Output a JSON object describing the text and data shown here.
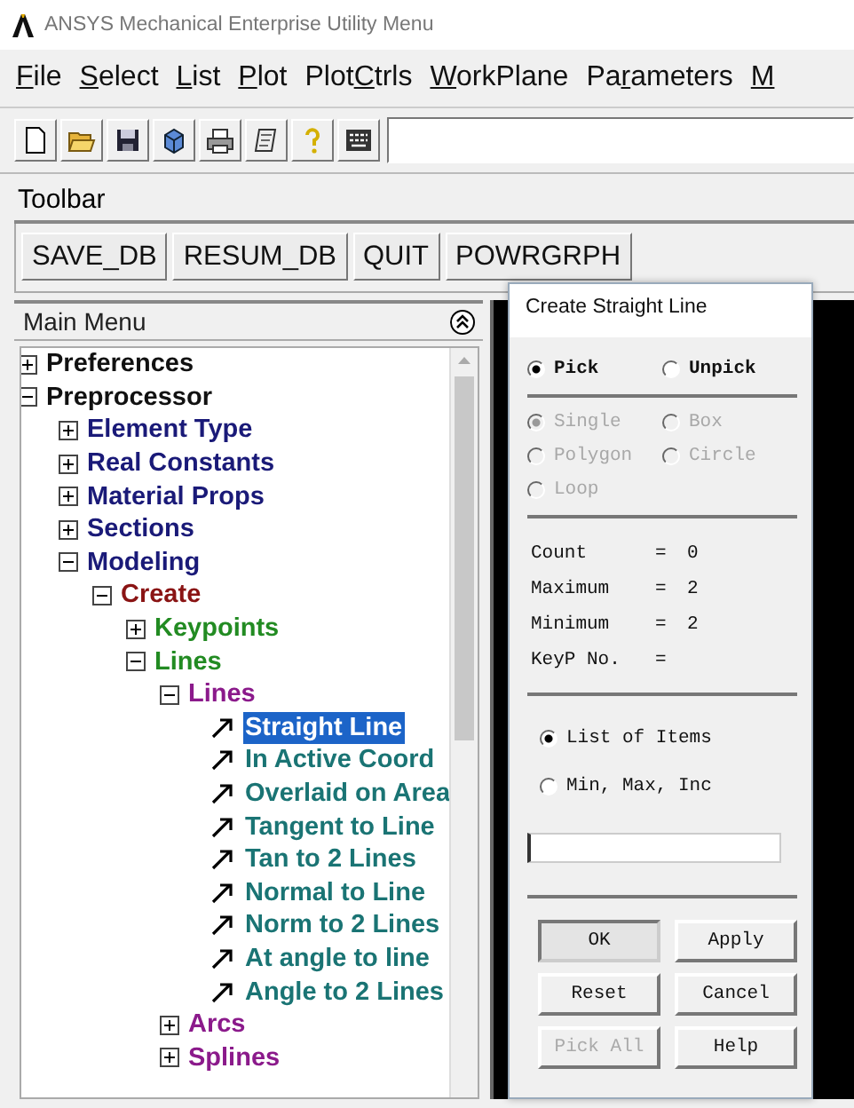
{
  "window": {
    "title": "ANSYS Mechanical Enterprise Utility Menu"
  },
  "menu_bar": [
    {
      "key": "F",
      "after": "ile"
    },
    {
      "key": "S",
      "after": "elect"
    },
    {
      "key": "L",
      "after": "ist"
    },
    {
      "key": "P",
      "after": "lot"
    },
    {
      "before": "Plot",
      "key": "C",
      "after": "trls"
    },
    {
      "key": "W",
      "after": "orkPlane"
    },
    {
      "before": "Pa",
      "key": "r",
      "after": "ameters"
    },
    {
      "key": "M"
    }
  ],
  "toolbar_label": "Toolbar",
  "toolbar_buttons": [
    "SAVE_DB",
    "RESUM_DB",
    "QUIT",
    "POWRGRPH"
  ],
  "main_menu": {
    "title": "Main Menu",
    "tree": [
      {
        "label": "Preferences",
        "kind": "folder",
        "expanded": false,
        "selected": false
      },
      {
        "label": "Preprocessor",
        "kind": "folder",
        "expanded": true,
        "selected": false,
        "children": [
          {
            "label": "Element Type",
            "kind": "folder",
            "expanded": false,
            "selected": false
          },
          {
            "label": "Real Constants",
            "kind": "folder",
            "expanded": false,
            "selected": false
          },
          {
            "label": "Material Props",
            "kind": "folder",
            "expanded": false,
            "selected": false
          },
          {
            "label": "Sections",
            "kind": "folder",
            "expanded": false,
            "selected": false
          },
          {
            "label": "Modeling",
            "kind": "folder",
            "expanded": true,
            "selected": false,
            "children": [
              {
                "label": "Create",
                "kind": "folder",
                "expanded": true,
                "selected": false,
                "children": [
                  {
                    "label": "Keypoints",
                    "kind": "folder",
                    "expanded": false,
                    "selected": false
                  },
                  {
                    "label": "Lines",
                    "kind": "folder",
                    "expanded": true,
                    "selected": false,
                    "children": [
                      {
                        "label": "Lines",
                        "kind": "folder",
                        "expanded": true,
                        "selected": false,
                        "children": [
                          {
                            "label": "Straight Line",
                            "kind": "action",
                            "selected": true
                          },
                          {
                            "label": "In Active Coord",
                            "kind": "action",
                            "selected": false
                          },
                          {
                            "label": "Overlaid on Area",
                            "kind": "action",
                            "selected": false
                          },
                          {
                            "label": "Tangent to Line",
                            "kind": "action",
                            "selected": false
                          },
                          {
                            "label": "Tan to 2 Lines",
                            "kind": "action",
                            "selected": false
                          },
                          {
                            "label": "Normal to Line",
                            "kind": "action",
                            "selected": false
                          },
                          {
                            "label": "Norm to 2 Lines",
                            "kind": "action",
                            "selected": false
                          },
                          {
                            "label": "At angle to line",
                            "kind": "action",
                            "selected": false
                          },
                          {
                            "label": "Angle to 2 Lines",
                            "kind": "action",
                            "selected": false
                          }
                        ]
                      },
                      {
                        "label": "Arcs",
                        "kind": "folder",
                        "expanded": false,
                        "selected": false
                      },
                      {
                        "label": "Splines",
                        "kind": "folder",
                        "expanded": false,
                        "selected": false
                      }
                    ]
                  }
                ]
              }
            ]
          }
        ]
      }
    ]
  },
  "dialog": {
    "title": "Create Straight Line",
    "mode": [
      {
        "label": "Pick",
        "selected": true
      },
      {
        "label": "Unpick",
        "selected": false
      }
    ],
    "pick_type": {
      "disabled": true,
      "options": [
        {
          "label": "Single",
          "selected": true
        },
        {
          "label": "Box",
          "selected": false
        },
        {
          "label": "Polygon",
          "selected": false
        },
        {
          "label": "Circle",
          "selected": false
        },
        {
          "label": "Loop",
          "selected": false
        }
      ]
    },
    "stats": [
      {
        "label": "Count",
        "sign": "=",
        "value": "0"
      },
      {
        "label": "Maximum",
        "sign": "=",
        "value": "2"
      },
      {
        "label": "Minimum",
        "sign": "=",
        "value": "2"
      },
      {
        "label": "KeyP No.",
        "sign": "="
      }
    ],
    "entry_mode": [
      {
        "label": "List of Items",
        "selected": true
      },
      {
        "label": "Min, Max, Inc",
        "selected": false
      }
    ],
    "buttons": [
      {
        "label": "OK",
        "disabled": false
      },
      {
        "label": "Apply",
        "disabled": false
      },
      {
        "label": "Reset",
        "disabled": false
      },
      {
        "label": "Cancel",
        "disabled": false
      },
      {
        "label": "Pick All",
        "disabled": true
      },
      {
        "label": "Help",
        "disabled": false
      }
    ]
  }
}
